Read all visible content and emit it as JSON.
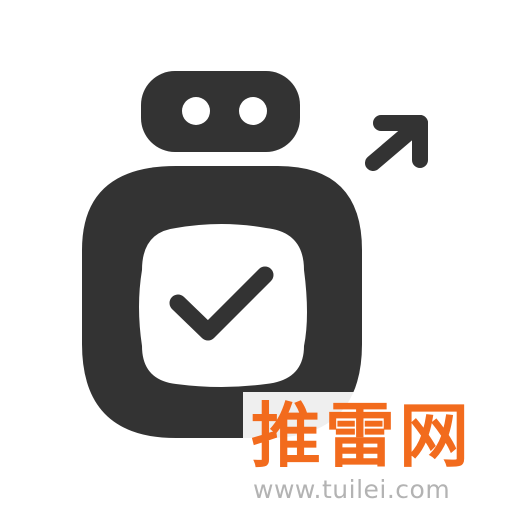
{
  "icon": {
    "name": "robot-check-share-icon",
    "color": "#333333"
  },
  "watermark": {
    "brand": "推雷网",
    "url": "www.tuilei.com",
    "brand_color": "#f26b1d",
    "url_color": "#b3b3b3"
  }
}
